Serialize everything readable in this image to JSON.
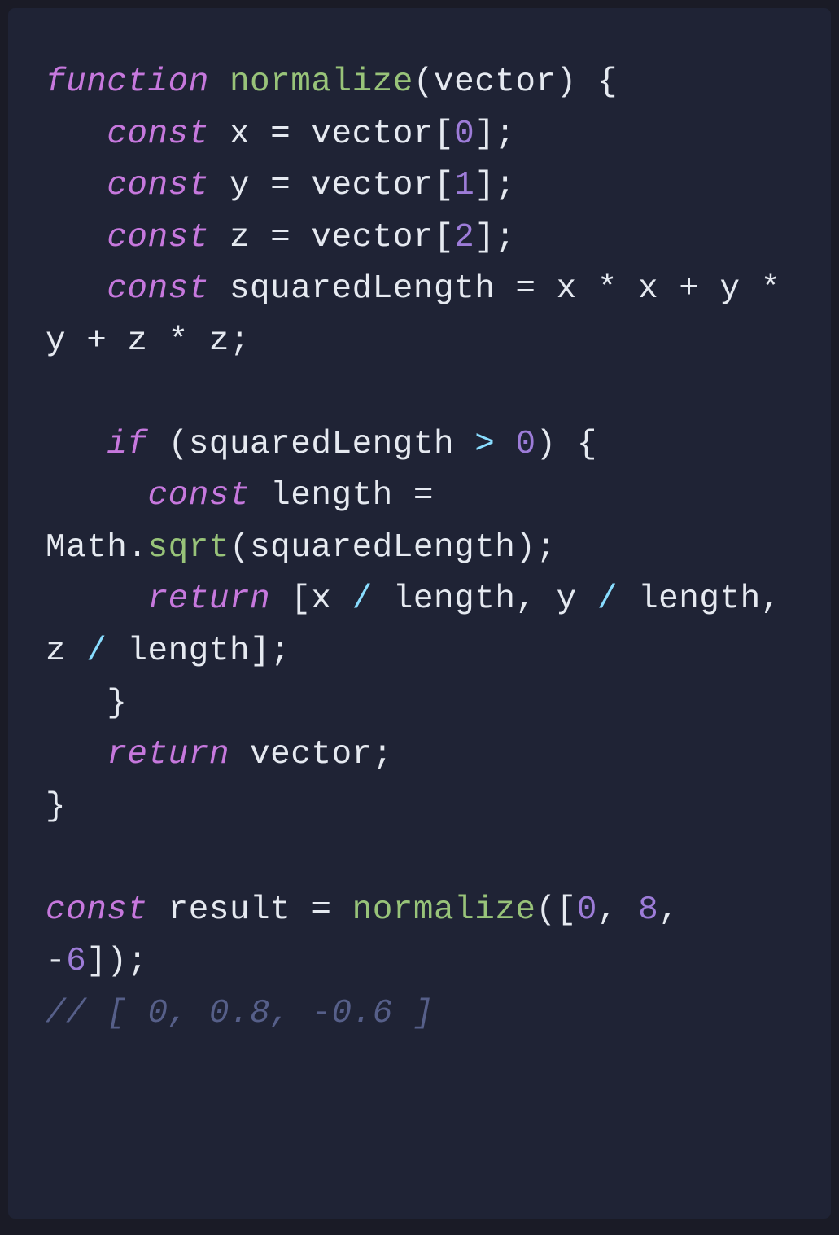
{
  "code": {
    "tokens": [
      {
        "cls": "kw",
        "t": "function"
      },
      {
        "cls": "id",
        "t": " "
      },
      {
        "cls": "fn",
        "t": "normalize"
      },
      {
        "cls": "pun",
        "t": "("
      },
      {
        "cls": "id",
        "t": "vector"
      },
      {
        "cls": "pun",
        "t": ")"
      },
      {
        "cls": "id",
        "t": " "
      },
      {
        "cls": "pun",
        "t": "{"
      },
      {
        "cls": "nl"
      },
      {
        "cls": "id",
        "t": "   "
      },
      {
        "cls": "kw",
        "t": "const"
      },
      {
        "cls": "id",
        "t": " x "
      },
      {
        "cls": "op",
        "t": "="
      },
      {
        "cls": "id",
        "t": " vector"
      },
      {
        "cls": "pun",
        "t": "["
      },
      {
        "cls": "num",
        "t": "0"
      },
      {
        "cls": "pun",
        "t": "];"
      },
      {
        "cls": "nl"
      },
      {
        "cls": "id",
        "t": "   "
      },
      {
        "cls": "kw",
        "t": "const"
      },
      {
        "cls": "id",
        "t": " y "
      },
      {
        "cls": "op",
        "t": "="
      },
      {
        "cls": "id",
        "t": " vector"
      },
      {
        "cls": "pun",
        "t": "["
      },
      {
        "cls": "num",
        "t": "1"
      },
      {
        "cls": "pun",
        "t": "];"
      },
      {
        "cls": "nl"
      },
      {
        "cls": "id",
        "t": "   "
      },
      {
        "cls": "kw",
        "t": "const"
      },
      {
        "cls": "id",
        "t": " z "
      },
      {
        "cls": "op",
        "t": "="
      },
      {
        "cls": "id",
        "t": " vector"
      },
      {
        "cls": "pun",
        "t": "["
      },
      {
        "cls": "num",
        "t": "2"
      },
      {
        "cls": "pun",
        "t": "];"
      },
      {
        "cls": "nl"
      },
      {
        "cls": "id",
        "t": "   "
      },
      {
        "cls": "kw",
        "t": "const"
      },
      {
        "cls": "id",
        "t": " squaredLength "
      },
      {
        "cls": "op",
        "t": "="
      },
      {
        "cls": "id",
        "t": " x "
      },
      {
        "cls": "op",
        "t": "*"
      },
      {
        "cls": "id",
        "t": " x "
      },
      {
        "cls": "op",
        "t": "+"
      },
      {
        "cls": "id",
        "t": " y "
      },
      {
        "cls": "op",
        "t": "*"
      },
      {
        "cls": "id",
        "t": " y "
      },
      {
        "cls": "op",
        "t": "+"
      },
      {
        "cls": "id",
        "t": " z "
      },
      {
        "cls": "op",
        "t": "*"
      },
      {
        "cls": "id",
        "t": " z"
      },
      {
        "cls": "pun",
        "t": ";"
      },
      {
        "cls": "nl"
      },
      {
        "cls": "nl"
      },
      {
        "cls": "id",
        "t": "   "
      },
      {
        "cls": "kw",
        "t": "if"
      },
      {
        "cls": "id",
        "t": " "
      },
      {
        "cls": "pun",
        "t": "("
      },
      {
        "cls": "id",
        "t": "squaredLength "
      },
      {
        "cls": "cmp",
        "t": ">"
      },
      {
        "cls": "id",
        "t": " "
      },
      {
        "cls": "num",
        "t": "0"
      },
      {
        "cls": "pun",
        "t": ")"
      },
      {
        "cls": "id",
        "t": " "
      },
      {
        "cls": "pun",
        "t": "{"
      },
      {
        "cls": "nl"
      },
      {
        "cls": "id",
        "t": "     "
      },
      {
        "cls": "kw",
        "t": "const"
      },
      {
        "cls": "id",
        "t": " length "
      },
      {
        "cls": "op",
        "t": "="
      },
      {
        "cls": "id",
        "t": " Math"
      },
      {
        "cls": "pun",
        "t": "."
      },
      {
        "cls": "fn",
        "t": "sqrt"
      },
      {
        "cls": "pun",
        "t": "("
      },
      {
        "cls": "id",
        "t": "squaredLength"
      },
      {
        "cls": "pun",
        "t": ");"
      },
      {
        "cls": "nl"
      },
      {
        "cls": "id",
        "t": "     "
      },
      {
        "cls": "kw",
        "t": "return"
      },
      {
        "cls": "id",
        "t": " "
      },
      {
        "cls": "pun",
        "t": "["
      },
      {
        "cls": "id",
        "t": "x "
      },
      {
        "cls": "cmp",
        "t": "/"
      },
      {
        "cls": "id",
        "t": " length"
      },
      {
        "cls": "pun",
        "t": ","
      },
      {
        "cls": "id",
        "t": " y "
      },
      {
        "cls": "cmp",
        "t": "/"
      },
      {
        "cls": "id",
        "t": " length"
      },
      {
        "cls": "pun",
        "t": ","
      },
      {
        "cls": "id",
        "t": " z "
      },
      {
        "cls": "cmp",
        "t": "/"
      },
      {
        "cls": "id",
        "t": " length"
      },
      {
        "cls": "pun",
        "t": "];"
      },
      {
        "cls": "nl"
      },
      {
        "cls": "id",
        "t": "   "
      },
      {
        "cls": "pun",
        "t": "}"
      },
      {
        "cls": "nl"
      },
      {
        "cls": "id",
        "t": "   "
      },
      {
        "cls": "kw",
        "t": "return"
      },
      {
        "cls": "id",
        "t": " vector"
      },
      {
        "cls": "pun",
        "t": ";"
      },
      {
        "cls": "nl"
      },
      {
        "cls": "pun",
        "t": "}"
      },
      {
        "cls": "nl"
      },
      {
        "cls": "nl"
      },
      {
        "cls": "kw",
        "t": "const"
      },
      {
        "cls": "id",
        "t": " result "
      },
      {
        "cls": "op",
        "t": "="
      },
      {
        "cls": "id",
        "t": " "
      },
      {
        "cls": "fn",
        "t": "normalize"
      },
      {
        "cls": "pun",
        "t": "(["
      },
      {
        "cls": "num",
        "t": "0"
      },
      {
        "cls": "pun",
        "t": ","
      },
      {
        "cls": "id",
        "t": " "
      },
      {
        "cls": "num",
        "t": "8"
      },
      {
        "cls": "pun",
        "t": ","
      },
      {
        "cls": "id",
        "t": " "
      },
      {
        "cls": "op",
        "t": "-"
      },
      {
        "cls": "num",
        "t": "6"
      },
      {
        "cls": "pun",
        "t": "]);"
      },
      {
        "cls": "nl"
      },
      {
        "cls": "comment",
        "t": "// [ 0, 0.8, -0.6 ]"
      }
    ]
  }
}
